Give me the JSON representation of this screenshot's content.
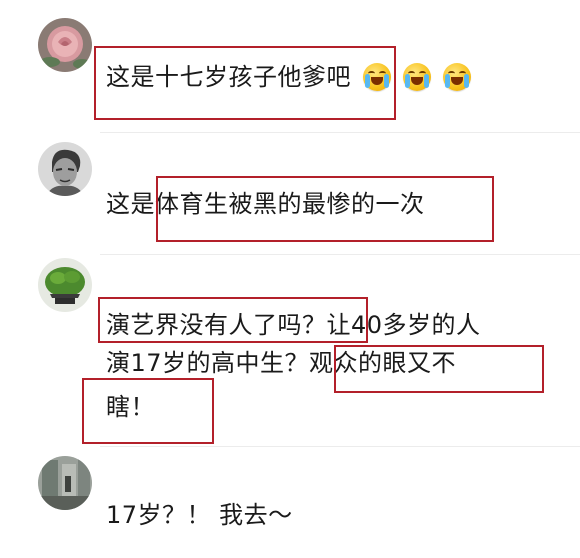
{
  "comments": [
    {
      "avatar": "rose-avatar",
      "lines": [
        "这是十七岁孩子他爹吧"
      ],
      "emoji": "crying-laughing-emoji"
    },
    {
      "avatar": "sketch-portrait-avatar",
      "lines": [
        "这是体育生被黑的最惨的一次"
      ]
    },
    {
      "avatar": "potted-plant-avatar",
      "lines": [
        "演艺界没有人了吗？让40多岁的人",
        "演17岁的高中生？观众的眼又不",
        "瞎！"
      ]
    },
    {
      "avatar": "street-photo-avatar",
      "lines": [
        "17岁？！ 我去～"
      ]
    }
  ],
  "highlight_color": "#b3202a"
}
